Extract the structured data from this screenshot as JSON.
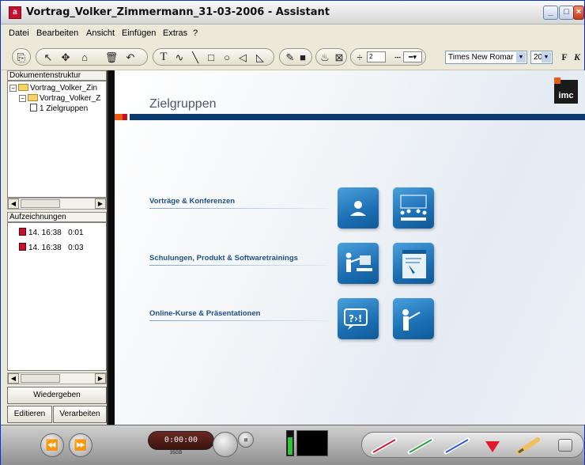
{
  "window": {
    "title": "Vortrag_Volker_Zimmermann_31-03-2006 - Assistant",
    "app_icon": "assistant-app-icon",
    "controls": [
      "minimize",
      "maximize",
      "close"
    ]
  },
  "menu": {
    "items": [
      "Datei",
      "Bearbeiten",
      "Ansicht",
      "Einfügen",
      "Extras",
      "?"
    ]
  },
  "toolbar": {
    "font_family": "Times New Romar",
    "font_size": "20",
    "bold_label": "F",
    "italic_label": "K",
    "spin_value": "2"
  },
  "left_panel": {
    "structure_label": "Dokumentenstruktur",
    "tree": [
      {
        "label": "Vortrag_Volker_Zin",
        "level": 0,
        "icon": "folder-icon"
      },
      {
        "label": "Vortrag_Volker_Z",
        "level": 1,
        "icon": "folder-icon"
      },
      {
        "label": "1 Zielgruppen",
        "level": 2,
        "icon": "page-icon"
      }
    ],
    "recordings_label": "Aufzeichnungen",
    "recordings": [
      {
        "label": "14. 16:38",
        "duration": "0:01"
      },
      {
        "label": "14. 16:38",
        "duration": "0:03"
      }
    ],
    "play_button": "Wiedergeben",
    "edit_button": "Editieren",
    "process_button": "Verarbeiten"
  },
  "slide": {
    "title": "Zielgruppen",
    "logo_text": "imc",
    "categories": [
      {
        "label": "Vorträge & Konferenzen",
        "icons": [
          "presenter-icon",
          "conference-icon"
        ]
      },
      {
        "label": "Schulungen, Produkt & Softwaretrainings",
        "icons": [
          "trainer-icon",
          "software-screen-icon"
        ]
      },
      {
        "label": "Online-Kurse & Präsentationen",
        "icons": [
          "speech-bubble-icon",
          "presenting-person-icon"
        ]
      }
    ]
  },
  "bottom_bar": {
    "time": "0:00:00",
    "time_sub": "35GB",
    "colors": {
      "pen_red": "#c41e3a",
      "pen_green": "#2ea043",
      "pen_blue": "#2a5bd7",
      "marker_red": "#e01a2a"
    }
  }
}
